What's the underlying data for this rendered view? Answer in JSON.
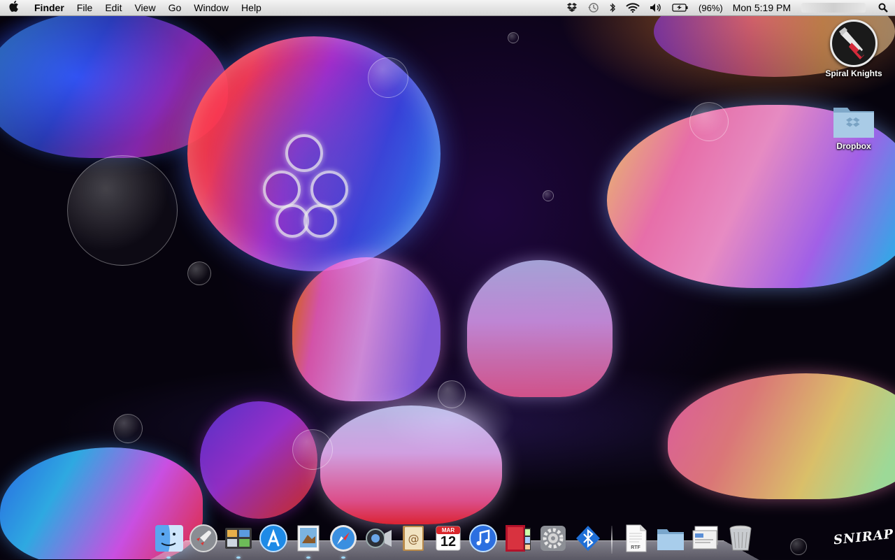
{
  "menubar": {
    "app_name": "Finder",
    "menus": [
      "File",
      "Edit",
      "View",
      "Go",
      "Window",
      "Help"
    ],
    "battery_percent": "(96%)",
    "clock": "Mon 5:19 PM",
    "icons": [
      "apple-logo",
      "dropbox-status",
      "time-machine",
      "bluetooth",
      "wifi",
      "volume",
      "battery",
      "spotlight"
    ]
  },
  "desktop": {
    "icons": [
      {
        "label": "Spiral Knights",
        "icon": "spiral-knights-app"
      },
      {
        "label": "Dropbox",
        "icon": "dropbox-folder"
      }
    ],
    "wallpaper_signature": "SNIRAP"
  },
  "dock": {
    "apps": [
      "Finder",
      "Launchpad",
      "Photo Browser",
      "App Store",
      "Preview",
      "Safari",
      "FaceTime",
      "Address Book",
      "iCal",
      "iTunes",
      "Photo Booth",
      "System Preferences",
      "Bluetooth File Exchange"
    ],
    "ical_month": "MAR",
    "ical_day": "12",
    "docs": [
      "RTF Document",
      "Folder",
      "Screenshots",
      "Trash"
    ],
    "rtf_label": "RTF"
  }
}
